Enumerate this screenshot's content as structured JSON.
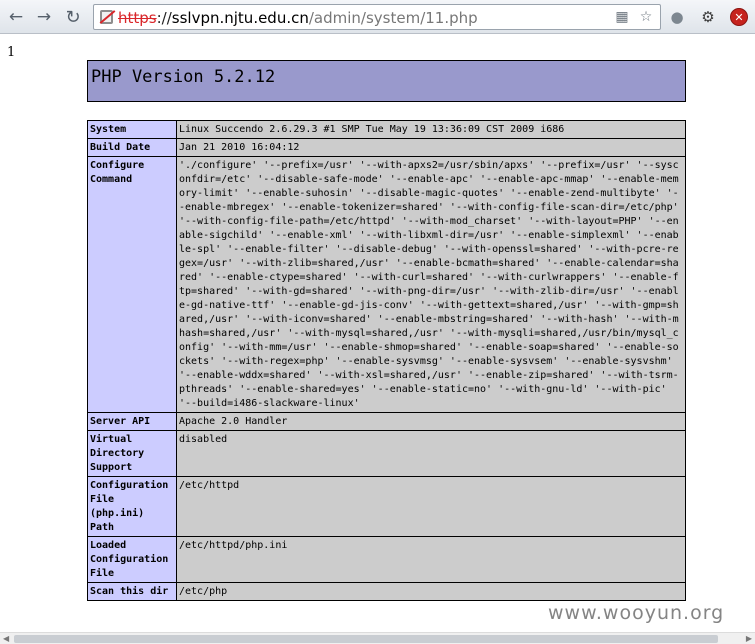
{
  "browser": {
    "back_icon": "back-arrow-icon",
    "forward_icon": "forward-arrow-icon",
    "reload_icon": "reload-icon",
    "url_protocol": "https",
    "url_sep": "://",
    "url_host": "sslvpn.njtu.edu.cn",
    "url_path": "/admin/system/11.php",
    "omnibox_icons": [
      "translate-icon",
      "star-icon"
    ],
    "extension_icons": [
      "globe-icon",
      "tool-icon",
      "stop-icon"
    ]
  },
  "page": {
    "echo_output": "1",
    "php_title": "PHP Version 5.2.12",
    "rows": [
      {
        "label": "System",
        "value": "Linux Succendo 2.6.29.3 #1 SMP Tue May 19 13:36:09 CST 2009 i686"
      },
      {
        "label": "Build Date",
        "value": "Jan 21 2010 16:04:12"
      },
      {
        "label": "Configure Command",
        "value": "'./configure' '--prefix=/usr' '--with-apxs2=/usr/sbin/apxs' '--prefix=/usr' '--sysconfdir=/etc' '--disable-safe-mode' '--enable-apc' '--enable-apc-mmap' '--enable-memory-limit' '--enable-suhosin' '--disable-magic-quotes' '--enable-zend-multibyte' '--enable-mbregex' '--enable-tokenizer=shared' '--with-config-file-scan-dir=/etc/php' '--with-config-file-path=/etc/httpd' '--with-mod_charset' '--with-layout=PHP' '--enable-sigchild' '--enable-xml' '--with-libxml-dir=/usr' '--enable-simplexml' '--enable-spl' '--enable-filter' '--disable-debug' '--with-openssl=shared' '--with-pcre-regex=/usr' '--with-zlib=shared,/usr' '--enable-bcmath=shared' '--enable-calendar=shared' '--enable-ctype=shared' '--with-curl=shared' '--with-curlwrappers' '--enable-ftp=shared' '--with-gd=shared' '--with-png-dir=/usr' '--with-zlib-dir=/usr' '--enable-gd-native-ttf' '--enable-gd-jis-conv' '--with-gettext=shared,/usr' '--with-gmp=shared,/usr' '--with-iconv=shared' '--enable-mbstring=shared' '--with-hash' '--with-mhash=shared,/usr' '--with-mysql=shared,/usr' '--with-mysqli=shared,/usr/bin/mysql_config' '--with-mm=/usr' '--enable-shmop=shared' '--enable-soap=shared' '--enable-sockets' '--with-regex=php' '--enable-sysvmsg' '--enable-sysvsem' '--enable-sysvshm' '--enable-wddx=shared' '--with-xsl=shared,/usr' '--enable-zip=shared' '--with-tsrm-pthreads' '--enable-shared=yes' '--enable-static=no' '--with-gnu-ld' '--with-pic' '--build=i486-slackware-linux'"
      },
      {
        "label": "Server API",
        "value": "Apache 2.0 Handler"
      },
      {
        "label": "Virtual Directory Support",
        "value": "disabled"
      },
      {
        "label": "Configuration File (php.ini) Path",
        "value": "/etc/httpd"
      },
      {
        "label": "Loaded Configuration File",
        "value": "/etc/httpd/php.ini"
      },
      {
        "label": "Scan this dir",
        "value": "/etc/php"
      }
    ]
  },
  "watermark": "www.wooyun.org",
  "colors": {
    "header_bg": "#9999cc",
    "label_bg": "#ccccff",
    "value_bg": "#cccccc"
  }
}
